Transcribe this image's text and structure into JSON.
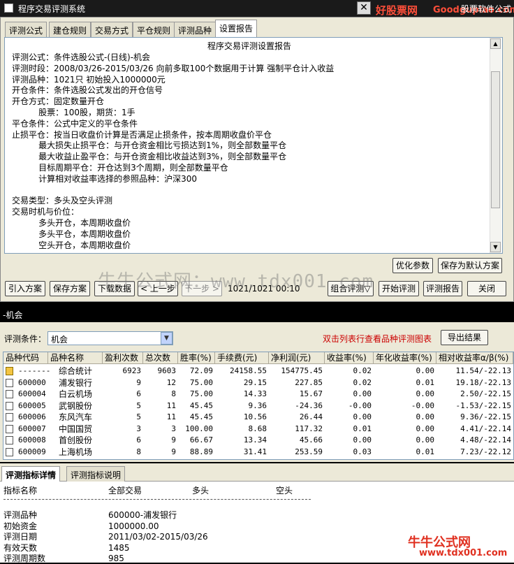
{
  "window": {
    "title": "程序交易评测系统",
    "right_text": "股票软件公式",
    "brand": "好股票网",
    "brand_url": "Goodgupiao.com"
  },
  "tabs": [
    "评测公式",
    "建仓规则",
    "交易方式",
    "平仓规则",
    "评测品种",
    "设置报告"
  ],
  "report": {
    "title": "程序交易评测设置报告",
    "lines": [
      "评测公式：条件选股公式-(日线)-机会",
      "评测时段：2008/03/26-2015/03/26 向前多取100个数据用于计算 强制平仓计入收益",
      "评测品种：1021只 初始投入1000000元",
      "开仓条件：条件选股公式发出的开仓信号",
      "开仓方式：固定数量开仓",
      "          股票：100股，期货：1手",
      "平仓条件：公式中定义的平仓条件",
      "止损平仓：按当日收盘价计算是否满足止损条件，按本周期收盘价平仓",
      "          最大损失止损平仓：与开仓资金相比亏损达到1%，则全部数量平仓",
      "          最大收益止盈平仓：与开仓资金相比收益达到3%，则全部数量平仓",
      "          目标周期平仓：开仓达到3个周期，则全部数量平仓",
      "          计算相对收益率选择的参照品种：沪深300",
      "",
      "交易类型：多头及空头评测",
      "交易时机与价位：",
      "          多头开仓，本周期收盘价",
      "          多头平仓，本周期收盘价",
      "          空头开仓，本周期收盘价"
    ]
  },
  "buttons": {
    "optimize": "优化参数",
    "save_default": "保存为默认方案",
    "import": "引入方案",
    "save": "保存方案",
    "download": "下载数据",
    "prev": "< 上一步",
    "next": "下一步 >",
    "progress": "1021/1021  00:10",
    "combo": "组合评测▽",
    "start": "开始评测",
    "report": "评测报告",
    "close": "关闭",
    "export": "导出结果"
  },
  "watermark": "牛牛公式网：www.tdx001.com",
  "lower": {
    "section_title": "-机会",
    "condition_label": "评测条件：",
    "condition_value": "机会",
    "hint": "双击列表行查看品种评测图表"
  },
  "columns": [
    "品种代码",
    "品种名称",
    "盈利次数",
    "总次数",
    "胜率(%)",
    "手续费(元)",
    "净利润(元)",
    "收益率(%)",
    "年化收益率(%)",
    "相对收益率",
    "α/β(%)"
  ],
  "rows": [
    [
      "-------",
      "综合统计",
      "6923",
      "9603",
      "72.09",
      "24158.55",
      "154775.45",
      "0.02",
      "0.00",
      "11.54/-22.13"
    ],
    [
      "600000",
      "浦发银行",
      "9",
      "12",
      "75.00",
      "29.15",
      "227.85",
      "0.02",
      "0.01",
      "19.18/-22.13"
    ],
    [
      "600004",
      "白云机场",
      "6",
      "8",
      "75.00",
      "14.33",
      "15.67",
      "0.00",
      "0.00",
      "2.50/-22.15"
    ],
    [
      "600005",
      "武钢股份",
      "5",
      "11",
      "45.45",
      "9.36",
      "-24.36",
      "-0.00",
      "-0.00",
      "-1.53/-22.15"
    ],
    [
      "600006",
      "东风汽车",
      "5",
      "11",
      "45.45",
      "10.56",
      "26.44",
      "0.00",
      "0.00",
      "9.36/-22.15"
    ],
    [
      "600007",
      "中国国贸",
      "3",
      "3",
      "100.00",
      "8.68",
      "117.32",
      "0.01",
      "0.00",
      "4.41/-22.14"
    ],
    [
      "600008",
      "首创股份",
      "6",
      "9",
      "66.67",
      "13.34",
      "45.66",
      "0.00",
      "0.00",
      "4.48/-22.14"
    ],
    [
      "600009",
      "上海机场",
      "8",
      "9",
      "88.89",
      "31.41",
      "253.59",
      "0.03",
      "0.01",
      "7.23/-22.12"
    ]
  ],
  "bottom_tabs": [
    "评测指标详情",
    "评测指标说明"
  ],
  "detail": {
    "headers": [
      "指标名称",
      "全部交易",
      "多头",
      "空头"
    ],
    "items": [
      [
        "评测品种",
        "600000-浦发银行"
      ],
      [
        "初始资金",
        "1000000.00"
      ],
      [
        "评测日期",
        "2011/03/02-2015/03/26"
      ],
      [
        "有效天数",
        "1485"
      ],
      [
        "评测周期数",
        "985"
      ]
    ]
  },
  "logo": {
    "text": "牛牛公式网",
    "url": "www.tdx001.com"
  }
}
